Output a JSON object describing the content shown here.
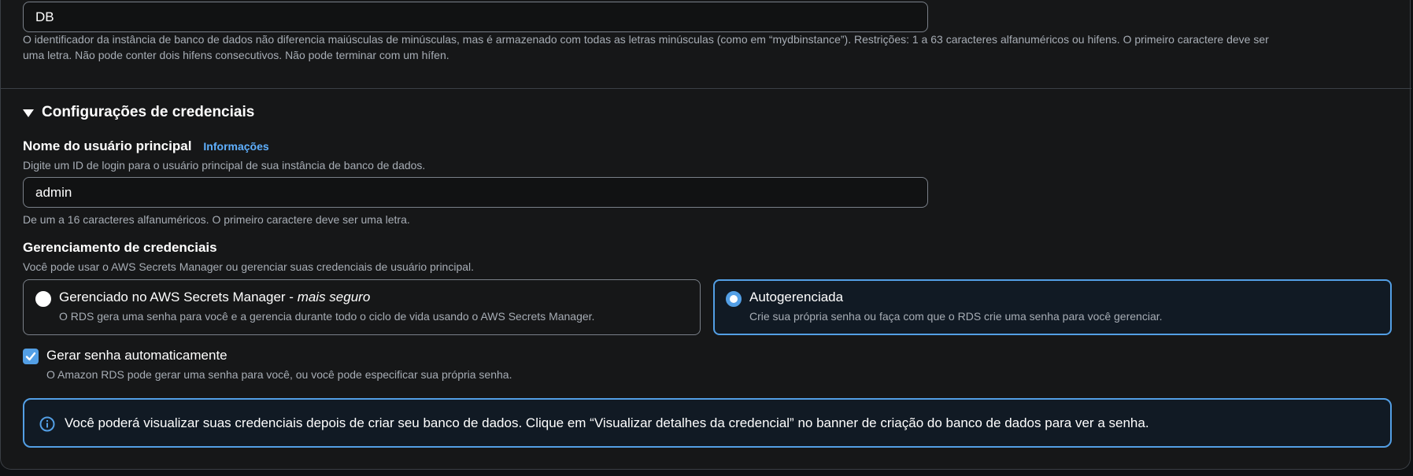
{
  "db_identifier": {
    "value": "DB",
    "hint_line1": "O identificador da instância de banco de dados não diferencia maiúsculas de minúsculas, mas é armazenado com todas as letras minúsculas (como em “mydbinstance”). Restrições: 1 a 63 caracteres alfanuméricos ou hifens. O primeiro caractere deve ser",
    "hint_line2": "uma letra. Não pode conter dois hifens consecutivos. Não pode terminar com um hífen."
  },
  "credentials_section": {
    "title": "Configurações de credenciais",
    "expanded": true
  },
  "master_username": {
    "label": "Nome do usuário principal",
    "info_link": "Informações",
    "description": "Digite um ID de login para o usuário principal de sua instância de banco de dados.",
    "value": "admin",
    "constraint": "De um a 16 caracteres alfanuméricos. O primeiro caractere deve ser uma letra."
  },
  "credential_management": {
    "label": "Gerenciamento de credenciais",
    "description": "Você pode usar o AWS Secrets Manager ou gerenciar suas credenciais de usuário principal.",
    "options": [
      {
        "title": "Gerenciado no AWS Secrets Manager - ",
        "title_emphasis": "mais seguro",
        "description": "O RDS gera uma senha para você e a gerencia durante todo o ciclo de vida usando o AWS Secrets Manager.",
        "selected": false
      },
      {
        "title": "Autogerenciada",
        "description": "Crie sua própria senha ou faça com que o RDS crie uma senha para você gerenciar.",
        "selected": true
      }
    ]
  },
  "auto_password": {
    "label": "Gerar senha automaticamente",
    "checked": true,
    "description": "O Amazon RDS pode gerar uma senha para você, ou você pode especificar sua própria senha."
  },
  "info_alert": {
    "icon": "info-icon",
    "text": "Você poderá visualizar suas credenciais depois de criar seu banco de dados. Clique em “Visualizar detalhes da credencial” no banner de criação do banco de dados para ver a senha."
  },
  "colors": {
    "accent": "#539fe5",
    "link": "#5fb0ff",
    "background": "#161718"
  }
}
